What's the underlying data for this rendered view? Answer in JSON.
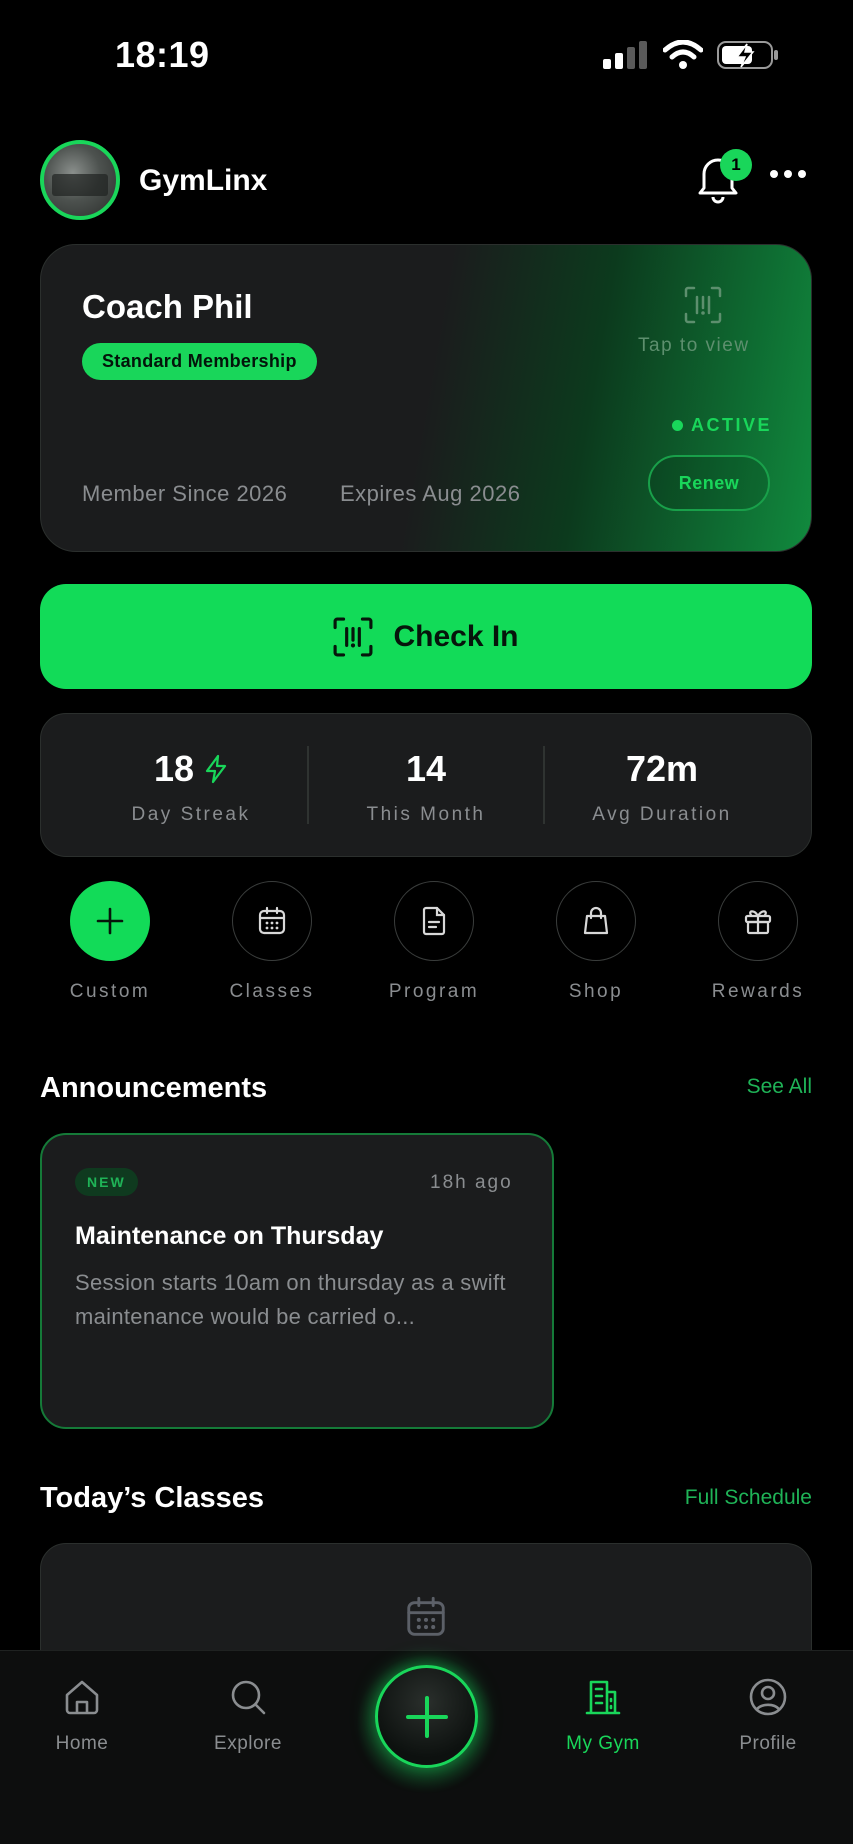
{
  "status_bar": {
    "time": "18:19"
  },
  "header": {
    "app_name": "GymLinx",
    "notification_count": "1",
    "icons": [
      "avatar",
      "bell-icon",
      "more-icon"
    ]
  },
  "membership": {
    "name": "Coach Phil",
    "plan": "Standard Membership",
    "tap_hint": "Tap to view",
    "status": "ACTIVE",
    "renew_label": "Renew",
    "member_since": "Member Since 2026",
    "expires": "Expires Aug 2026",
    "accent": "#19d65a"
  },
  "checkin": {
    "label": "Check In",
    "icon": "qr-scan-icon"
  },
  "stats": [
    {
      "value": "18",
      "label": "Day Streak",
      "icon": "bolt-icon"
    },
    {
      "value": "14",
      "label": "This Month"
    },
    {
      "value": "72m",
      "label": "Avg Duration"
    }
  ],
  "actions": [
    {
      "label": "Custom",
      "icon": "plus-icon"
    },
    {
      "label": "Classes",
      "icon": "calendar-icon"
    },
    {
      "label": "Program",
      "icon": "document-icon"
    },
    {
      "label": "Shop",
      "icon": "shopping-bag-icon"
    },
    {
      "label": "Rewards",
      "icon": "gift-icon"
    }
  ],
  "announcements": {
    "title": "Announcements",
    "link": "See All",
    "items": [
      {
        "badge": "NEW",
        "time": "18h ago",
        "title": "Maintenance on Thursday",
        "body": "Session starts 10am on thursday as a swift maintenance would be carried o..."
      }
    ]
  },
  "classes": {
    "title": "Today’s Classes",
    "link": "Full Schedule"
  },
  "tabbar": {
    "items": [
      {
        "label": "Home",
        "icon": "home-icon"
      },
      {
        "label": "Explore",
        "icon": "search-icon"
      },
      {
        "label": "My Gym",
        "icon": "building-icon",
        "active": true
      },
      {
        "label": "Profile",
        "icon": "user-circle-icon"
      }
    ],
    "center_icon": "plus-icon"
  }
}
